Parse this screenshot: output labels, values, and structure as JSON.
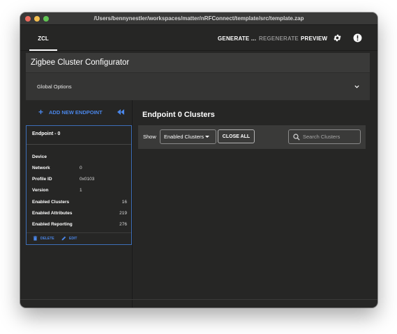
{
  "window": {
    "title": "/Users/bennynestler/workspaces/matter/nRFConnect/template/src/template.zap"
  },
  "topbar": {
    "tab": "ZCL",
    "generate_label": "GENERATE ...",
    "regenerate_label": "REGENERATE",
    "preview_label": "PREVIEW",
    "icons": [
      "gear-icon",
      "alert-icon"
    ]
  },
  "config": {
    "title": "Zigbee Cluster Configurator",
    "global_options_label": "Global Options"
  },
  "sidebar": {
    "add_endpoint_label": "ADD NEW ENDPOINT",
    "endpoint": {
      "title": "Endpoint - 0",
      "device_label": "Device",
      "device_value": "",
      "network_label": "Network",
      "network_value": "0",
      "profile_label": "Profile ID",
      "profile_value": "0x0103",
      "version_label": "Version",
      "version_value": "1",
      "enabled_clusters_label": "Enabled Clusters",
      "enabled_clusters_value": "16",
      "enabled_attributes_label": "Enabled Attributes",
      "enabled_attributes_value": "219",
      "enabled_reporting_label": "Enabled Reporting",
      "enabled_reporting_value": "276",
      "delete_label": "DELETE",
      "edit_label": "EDIT"
    }
  },
  "main": {
    "title": "Endpoint 0 Clusters",
    "show_label": "Show",
    "filter_value": "Enabled Clusters",
    "close_all_label": "CLOSE ALL",
    "search_placeholder": "Search Clusters"
  },
  "colors": {
    "accent": "#4a86e8",
    "background": "#262625",
    "panel": "#3a3a39"
  }
}
